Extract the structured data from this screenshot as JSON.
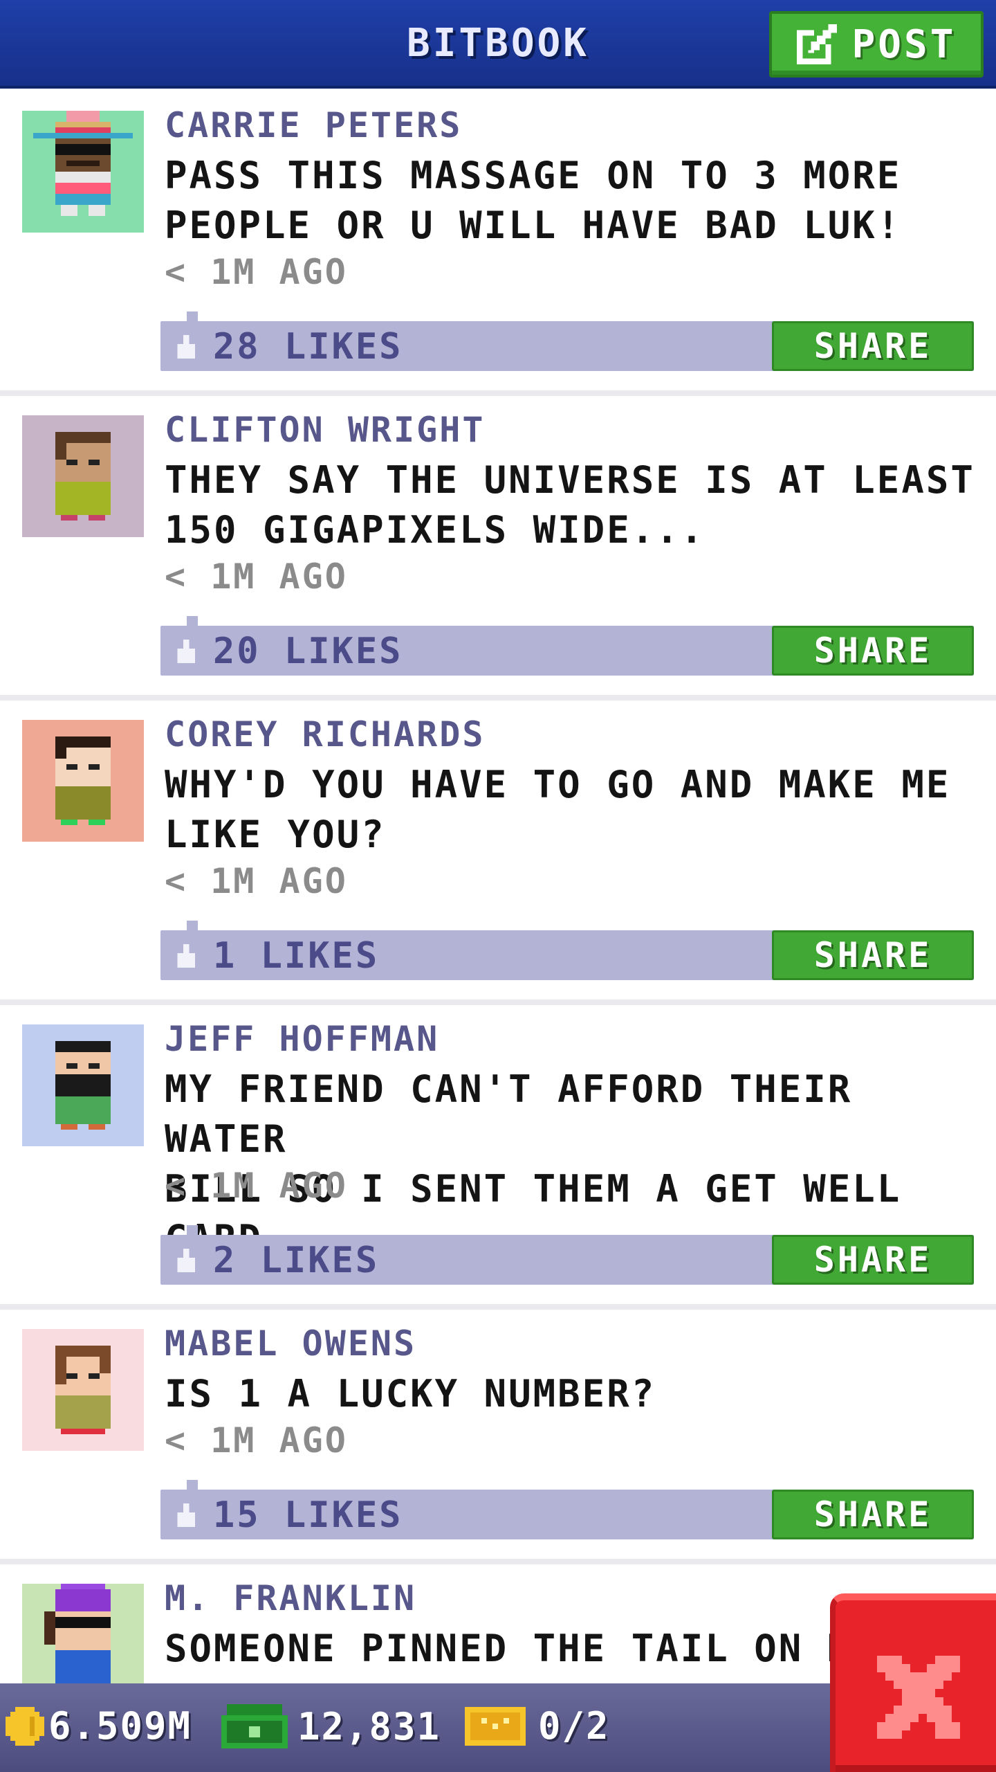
{
  "header": {
    "title": "BITBOOK",
    "post_label": "POST"
  },
  "posts": [
    {
      "author": "CARRIE PETERS",
      "message": "PASS THIS MASSAGE ON TO 3 MORE\nPEOPLE OR U WILL HAVE BAD LUK!",
      "time": "< 1M AGO",
      "likes": "28 LIKES",
      "share": "SHARE",
      "avatar_bg": "#86deac"
    },
    {
      "author": "CLIFTON WRIGHT",
      "message": "THEY SAY THE UNIVERSE IS AT LEAST\n150 GIGAPIXELS WIDE...",
      "time": "< 1M AGO",
      "likes": "20 LIKES",
      "share": "SHARE",
      "avatar_bg": "#c7b4c6"
    },
    {
      "author": "COREY RICHARDS",
      "message": "WHY'D YOU HAVE TO GO AND MAKE ME\nLIKE YOU?",
      "time": "< 1M AGO",
      "likes": "1 LIKES",
      "share": "SHARE",
      "avatar_bg": "#efa894"
    },
    {
      "author": "JEFF HOFFMAN",
      "message": "MY FRIEND CAN'T AFFORD THEIR WATER\nBILL SO I SENT THEM A GET WELL CARD.",
      "time": "< 1M AGO",
      "likes": "2 LIKES",
      "share": "SHARE",
      "avatar_bg": "#bfcdf1"
    },
    {
      "author": "MABEL OWENS",
      "message": "IS 1 A LUCKY NUMBER?",
      "time": "< 1M AGO",
      "likes": "15 LIKES",
      "share": "SHARE",
      "avatar_bg": "#f8dcdf"
    },
    {
      "author": "M. FRANKLIN",
      "message": "SOMEONE PINNED THE TAIL ON M",
      "avatar_bg": "#c8e4b4"
    }
  ],
  "bottombar": {
    "coins": "6.509M",
    "bux": "12,831",
    "tickets": "0/2"
  },
  "colors": {
    "header_blue": "#1f3fa8",
    "share_green": "#42a835",
    "likes_bar": "#b3b3d6",
    "close_red": "#e8232a"
  }
}
